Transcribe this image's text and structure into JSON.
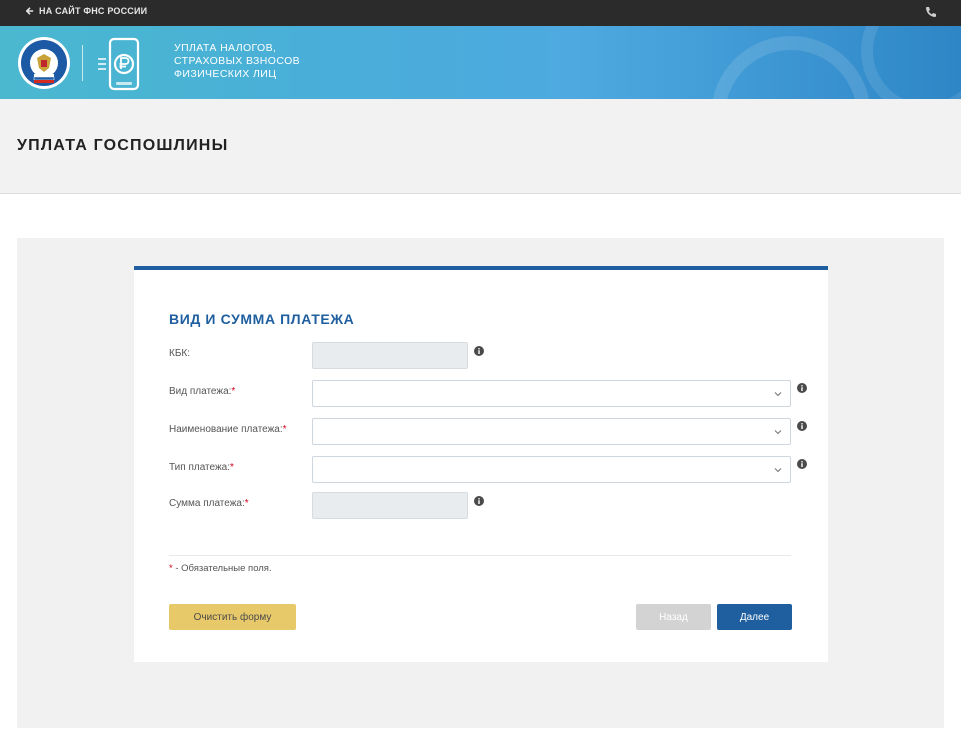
{
  "topbar": {
    "back_link": "НА САЙТ ФНС РОССИИ",
    "back_icon": "arrow-left-icon",
    "phone_icon": "phone-icon"
  },
  "header": {
    "title_lines": [
      "УПЛАТА НАЛОГОВ,",
      "СТРАХОВЫХ ВЗНОСОВ",
      "ФИЗИЧЕСКИХ ЛИЦ"
    ],
    "emblem_icon": "fns-emblem-icon",
    "app_logo_icon": "ruble-phone-icon",
    "gradient_start": "#4bb8cf",
    "gradient_end": "#2e86c6"
  },
  "page": {
    "title": "УПЛАТА ГОСПОШЛИНЫ"
  },
  "form": {
    "section_title": "ВИД И СУММА ПЛАТЕЖА",
    "fields": {
      "kbk": {
        "label": "КБК:",
        "required": "",
        "value": ""
      },
      "payment_kind": {
        "label": "Вид платежа:",
        "required": "*",
        "value": ""
      },
      "payment_name": {
        "label": "Наименование платежа:",
        "required": "*",
        "value": ""
      },
      "payment_type": {
        "label": "Тип платежа:",
        "required": "*",
        "value": ""
      },
      "payment_amount": {
        "label": "Сумма платежа:",
        "required": "*",
        "value": ""
      }
    },
    "required_note": {
      "star": "*",
      "text": " - Обязательные поля."
    },
    "buttons": {
      "clear": "Очистить форму",
      "back": "Назад",
      "next": "Далее"
    }
  },
  "colors": {
    "accent": "#1f5f9f",
    "required": "#d0021b",
    "clear_button": "#e8c96a",
    "disabled_button": "#d3d3d3"
  }
}
